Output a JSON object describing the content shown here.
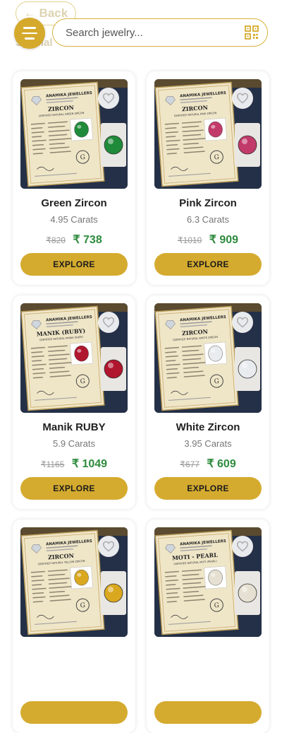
{
  "header": {
    "back_label": "← Back",
    "ghost_label": "Special",
    "search_placeholder": "Search jewelry..."
  },
  "icons": {
    "menu": "menu-icon",
    "scan": "qr-scan-icon",
    "favorite": "heart-icon"
  },
  "colors": {
    "accent": "#d5ab2f",
    "price_green": "#2e8b3e"
  },
  "products": [
    {
      "name": "Green Zircon",
      "carats": "4.95 Carats",
      "old_price": "₹820",
      "price": "₹ 738",
      "button": "EXPLORE",
      "certificate": {
        "company": "ANAMIKA JEWELLERS",
        "stone": "ZIRCON",
        "subtitle": "CERTIFIED NATURAL GREEN ZIRCON",
        "gem_color": "#1f8a3a"
      }
    },
    {
      "name": "Pink Zircon",
      "carats": "6.3 Carats",
      "old_price": "₹1010",
      "price": "₹ 909",
      "button": "EXPLORE",
      "certificate": {
        "company": "ANAMIKA JEWELLERS",
        "stone": "ZIRCON",
        "subtitle": "CERTIFIED NATURAL PINK ZIRCON",
        "gem_color": "#c23a6a"
      }
    },
    {
      "name": "Manik RUBY",
      "carats": "5.9 Carats",
      "old_price": "₹1165",
      "price": "₹ 1049",
      "button": "EXPLORE",
      "certificate": {
        "company": "ANAMIKA JEWELLERS",
        "stone": "MANIK (RUBY)",
        "subtitle": "CERTIFIED NATURAL MANIK (RUBY)",
        "gem_color": "#b0162e"
      }
    },
    {
      "name": "White Zircon",
      "carats": "3.95 Carats",
      "old_price": "₹677",
      "price": "₹ 609",
      "button": "EXPLORE",
      "certificate": {
        "company": "ANAMIKA JEWELLERS",
        "stone": "ZIRCON",
        "subtitle": "CERTIFIED NATURAL WHITE ZIRCON",
        "gem_color": "#e8ecef"
      }
    },
    {
      "name": "",
      "carats": "",
      "old_price": "",
      "price": "",
      "button": "",
      "certificate": {
        "company": "ANAMIKA JEWELLERS",
        "stone": "ZIRCON",
        "subtitle": "CERTIFIED NATURAL YELLOW ZIRCON",
        "gem_color": "#d9a81e"
      }
    },
    {
      "name": "",
      "carats": "",
      "old_price": "",
      "price": "",
      "button": "",
      "certificate": {
        "company": "ANAMIKA JEWELLERS",
        "stone": "MOTI - PEARL",
        "subtitle": "CERTIFIED NATURAL MOTI (PEARL)",
        "gem_color": "#e6e0d2"
      }
    }
  ]
}
